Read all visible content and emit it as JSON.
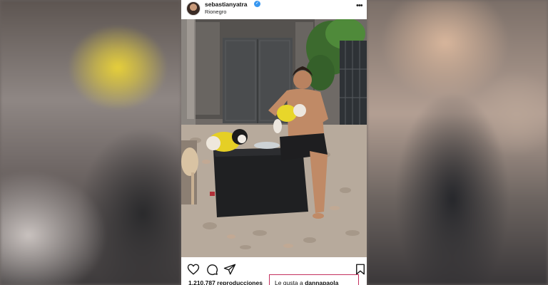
{
  "post": {
    "username": "sebastianyatra",
    "location": "Rionegro",
    "views_text": "1.210.787 reproducciones",
    "likes_prefix": "Le gusta a",
    "likes_user": "dannapaola"
  },
  "icons": {
    "verified": "verified-badge-icon",
    "more": "more-options-icon",
    "like": "heart-icon",
    "comment": "comment-icon",
    "share": "send-icon",
    "save": "bookmark-icon"
  },
  "colors": {
    "verified": "#3897f0",
    "highlight_box": "#c4315f"
  }
}
